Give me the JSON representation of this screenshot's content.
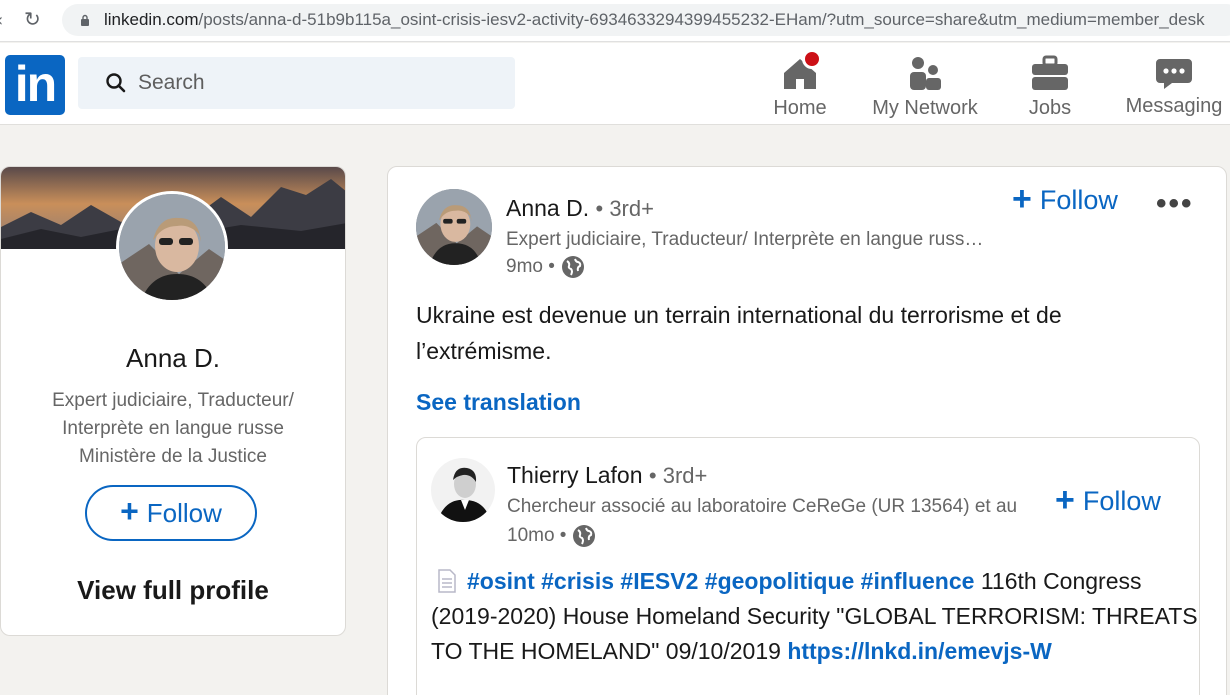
{
  "browser": {
    "url_host": "linkedin.com",
    "url_path": "/posts/anna-d-51b9b115a_osint-crisis-iesv2-activity-6934633294399455232-EHam/?utm_source=share&utm_medium=member_desk"
  },
  "header": {
    "logo": "in",
    "search_placeholder": "Search",
    "nav": [
      {
        "label": "Home",
        "icon": "home-icon",
        "badge": true
      },
      {
        "label": "My Network",
        "icon": "network-icon"
      },
      {
        "label": "Jobs",
        "icon": "briefcase-icon"
      },
      {
        "label": "Messaging",
        "icon": "messaging-icon"
      }
    ]
  },
  "profile": {
    "name": "Anna D.",
    "headline": "Expert judiciaire, Traducteur/ Interprète en langue russe Ministère de la Justice",
    "follow_label": "Follow",
    "view_profile_label": "View full profile"
  },
  "post": {
    "author": "Anna D.",
    "degree": "• 3rd+",
    "headline": "Expert judiciaire, Traducteur/ Interprète en langue russe Ministère de la Justice",
    "time": "9mo •",
    "follow_label": "Follow",
    "more_label": "•••",
    "text": "Ukraine est devenue un terrain international du terrorisme et de l’extrémisme.",
    "see_translation": "See translation",
    "shared": {
      "author": "Thierry Lafon",
      "degree": "• 3rd+",
      "headline": "Chercheur associé au laboratoire CeReGe (UR 13564) et au",
      "time": "10mo •",
      "follow_label": "Follow",
      "hashtags": "#osint #crisis #IESV2 #geopolitique #influence",
      "body": " 116th Congress (2019-2020) House Homeland Security \"GLOBAL TERRORISM: THREATS TO THE HOMELAND\" 09/10/2019 ",
      "link": "https://lnkd.in/emevjs-W"
    }
  },
  "colors": {
    "linkedin_blue": "#0a66c2",
    "badge_red": "#cc1016",
    "page_bg": "#f3f2ef"
  }
}
